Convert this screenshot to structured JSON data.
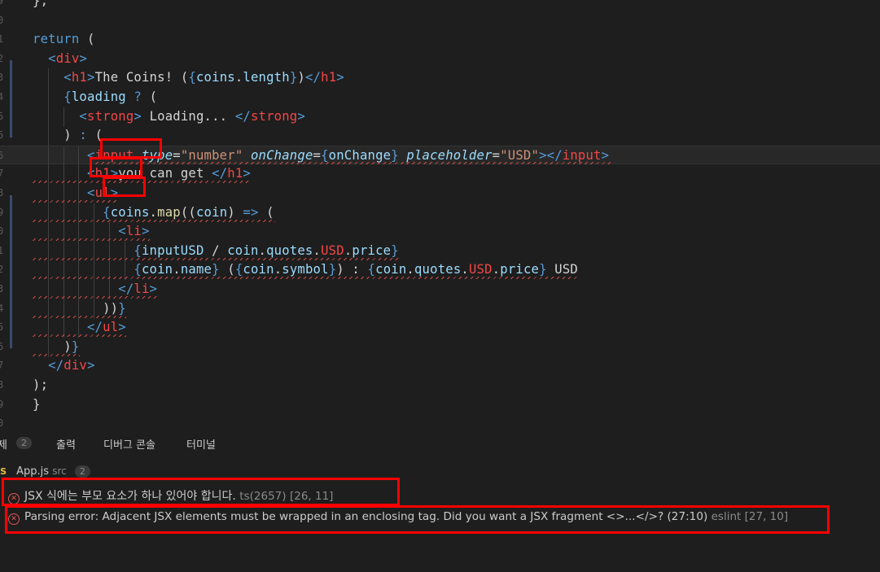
{
  "editor": {
    "lines": [
      {
        "n": "9",
        "parts": [
          [
            "txt",
            "};"
          ]
        ]
      },
      {
        "n": "0",
        "parts": []
      },
      {
        "n": "1",
        "parts": [
          [
            "k",
            "return"
          ],
          [
            "txt",
            " ("
          ]
        ]
      },
      {
        "n": "2",
        "parts": [
          [
            "txt",
            "  "
          ],
          [
            "k",
            "<"
          ],
          [
            "t",
            "div"
          ],
          [
            "k",
            ">"
          ]
        ]
      },
      {
        "n": "3",
        "parts": [
          [
            "txt",
            "    "
          ],
          [
            "k",
            "<"
          ],
          [
            "t",
            "h1"
          ],
          [
            "k",
            ">"
          ],
          [
            "txt",
            "The Coins! ("
          ],
          [
            "k",
            "{"
          ],
          [
            "v",
            "coins"
          ],
          [
            "txt",
            "."
          ],
          [
            "v",
            "length"
          ],
          [
            "k",
            "}"
          ],
          [
            "txt",
            ")"
          ],
          [
            "k",
            "</"
          ],
          [
            "t",
            "h1"
          ],
          [
            "k",
            ">"
          ]
        ]
      },
      {
        "n": "4",
        "parts": [
          [
            "txt",
            "    "
          ],
          [
            "k",
            "{"
          ],
          [
            "v",
            "loading"
          ],
          [
            "txt",
            " "
          ],
          [
            "k",
            "?"
          ],
          [
            "txt",
            " ("
          ]
        ]
      },
      {
        "n": "5",
        "parts": [
          [
            "txt",
            "      "
          ],
          [
            "k",
            "<"
          ],
          [
            "t",
            "strong"
          ],
          [
            "k",
            ">"
          ],
          [
            "txt",
            " Loading... "
          ],
          [
            "k",
            "</"
          ],
          [
            "t",
            "strong"
          ],
          [
            "k",
            ">"
          ]
        ]
      },
      {
        "n": "6",
        "parts": [
          [
            "txt",
            "    ) "
          ],
          [
            "k",
            ":"
          ],
          [
            "txt",
            " ("
          ]
        ]
      },
      {
        "n": "6",
        "parts": [
          [
            "txt",
            "       "
          ],
          [
            "k",
            "<"
          ],
          [
            "t",
            "input"
          ],
          [
            "txt",
            " "
          ],
          [
            "a",
            "type"
          ],
          [
            "txt",
            "="
          ],
          [
            "s",
            "\"number\""
          ],
          [
            "txt",
            " "
          ],
          [
            "a",
            "onChange"
          ],
          [
            "txt",
            "="
          ],
          [
            "k",
            "{"
          ],
          [
            "v",
            "onChange"
          ],
          [
            "k",
            "}"
          ],
          [
            "txt",
            " "
          ],
          [
            "a",
            "placeholder"
          ],
          [
            "txt",
            "="
          ],
          [
            "s",
            "\"USD\""
          ],
          [
            "k",
            "></"
          ],
          [
            "t",
            "input"
          ],
          [
            "k",
            ">"
          ]
        ]
      },
      {
        "n": "7",
        "parts": [
          [
            "txt",
            "       "
          ],
          [
            "k",
            "<"
          ],
          [
            "t",
            "h1"
          ],
          [
            "k",
            ">"
          ],
          [
            "txt",
            "you can get "
          ],
          [
            "k",
            "</"
          ],
          [
            "t",
            "h1"
          ],
          [
            "k",
            ">"
          ]
        ]
      },
      {
        "n": "8",
        "parts": [
          [
            "txt",
            "       "
          ],
          [
            "k",
            "<"
          ],
          [
            "t",
            "ul"
          ],
          [
            "k",
            ">"
          ]
        ]
      },
      {
        "n": "9",
        "parts": [
          [
            "txt",
            "         "
          ],
          [
            "k",
            "{"
          ],
          [
            "v",
            "coins"
          ],
          [
            "txt",
            "."
          ],
          [
            "f",
            "map"
          ],
          [
            "txt",
            "(("
          ],
          [
            "v",
            "coin"
          ],
          [
            "txt",
            ") "
          ],
          [
            "k",
            "=>"
          ],
          [
            "txt",
            " ("
          ]
        ]
      },
      {
        "n": "0",
        "parts": [
          [
            "txt",
            "           "
          ],
          [
            "k",
            "<"
          ],
          [
            "t",
            "li"
          ],
          [
            "k",
            ">"
          ]
        ]
      },
      {
        "n": "1",
        "parts": [
          [
            "txt",
            "             "
          ],
          [
            "k",
            "{"
          ],
          [
            "v",
            "inputUSD"
          ],
          [
            "txt",
            " / "
          ],
          [
            "v",
            "coin"
          ],
          [
            "txt",
            "."
          ],
          [
            "v",
            "quotes"
          ],
          [
            "txt",
            "."
          ],
          [
            "t",
            "USD"
          ],
          [
            "txt",
            "."
          ],
          [
            "v",
            "price"
          ],
          [
            "k",
            "}"
          ]
        ]
      },
      {
        "n": "2",
        "parts": [
          [
            "txt",
            "             "
          ],
          [
            "k",
            "{"
          ],
          [
            "v",
            "coin"
          ],
          [
            "txt",
            "."
          ],
          [
            "v",
            "name"
          ],
          [
            "k",
            "}"
          ],
          [
            "txt",
            " ("
          ],
          [
            "k",
            "{"
          ],
          [
            "v",
            "coin"
          ],
          [
            "txt",
            "."
          ],
          [
            "v",
            "symbol"
          ],
          [
            "k",
            "}"
          ],
          [
            "txt",
            ") : "
          ],
          [
            "k",
            "{"
          ],
          [
            "v",
            "coin"
          ],
          [
            "txt",
            "."
          ],
          [
            "v",
            "quotes"
          ],
          [
            "txt",
            "."
          ],
          [
            "t",
            "USD"
          ],
          [
            "txt",
            "."
          ],
          [
            "v",
            "price"
          ],
          [
            "k",
            "}"
          ],
          [
            "txt",
            " USD"
          ]
        ]
      },
      {
        "n": "3",
        "parts": [
          [
            "txt",
            "           "
          ],
          [
            "k",
            "</"
          ],
          [
            "t",
            "li"
          ],
          [
            "k",
            ">"
          ]
        ]
      },
      {
        "n": "4",
        "parts": [
          [
            "txt",
            "         ))"
          ],
          [
            "k",
            "}"
          ]
        ]
      },
      {
        "n": "5",
        "parts": [
          [
            "txt",
            "       "
          ],
          [
            "k",
            "</"
          ],
          [
            "t",
            "ul"
          ],
          [
            "k",
            ">"
          ]
        ]
      },
      {
        "n": "6",
        "parts": [
          [
            "txt",
            "    )"
          ],
          [
            "k",
            "}"
          ]
        ]
      },
      {
        "n": "7",
        "parts": [
          [
            "txt",
            "  "
          ],
          [
            "k",
            "</"
          ],
          [
            "t",
            "div"
          ],
          [
            "k",
            ">"
          ]
        ]
      },
      {
        "n": "8",
        "parts": [
          [
            "txt",
            ");"
          ]
        ]
      },
      {
        "n": "9",
        "parts": [
          [
            "txt",
            "}"
          ]
        ]
      },
      {
        "n": "0",
        "parts": []
      }
    ]
  },
  "panel": {
    "tabs": [
      {
        "label": "제",
        "badge": "2"
      },
      {
        "label": "출력"
      },
      {
        "label": "디버그 콘솔"
      },
      {
        "label": "터미널"
      }
    ],
    "file": {
      "icon": "JS",
      "name": "App.js",
      "dir": "src",
      "count": "2"
    },
    "problems": [
      {
        "message": "JSX 식에는 부모 요소가 하나 있어야 합니다.",
        "source": "ts(2657)",
        "position": "[26, 11]"
      },
      {
        "message": "Parsing error: Adjacent JSX elements must be wrapped in an enclosing tag. Did you want a JSX fragment <>...</>? (27:10)",
        "source": "eslint",
        "position": "[27, 10]"
      }
    ]
  },
  "colors": {
    "error": "#f44747",
    "keyword": "#569cd6",
    "string": "#ce9178",
    "variable": "#9cdcfe",
    "highlight": "#ff0000"
  }
}
